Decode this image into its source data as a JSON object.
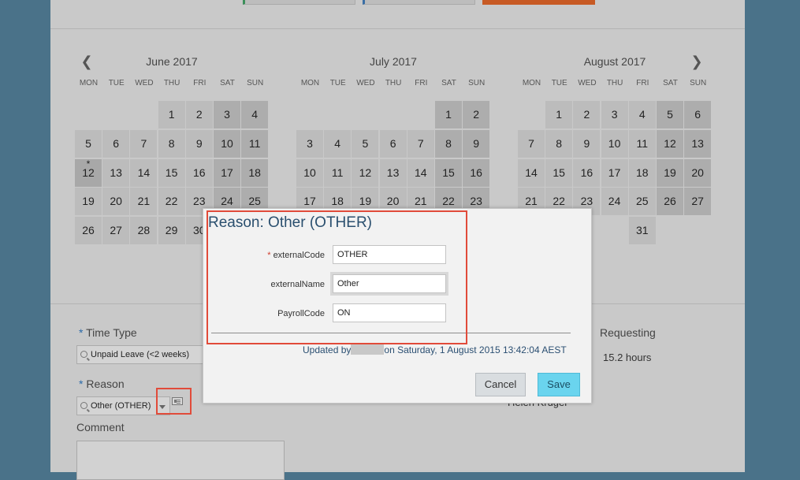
{
  "calendar": {
    "prev_icon": "chevron-left-icon",
    "next_icon": "chevron-right-icon",
    "weekdays": [
      "MON",
      "TUE",
      "WED",
      "THU",
      "FRI",
      "SAT",
      "SUN"
    ],
    "months": [
      {
        "title": "June 2017",
        "weeks": [
          [
            "",
            "",
            "",
            "1",
            "2",
            "3",
            "4"
          ],
          [
            "5",
            "6",
            "7",
            "8",
            "9",
            "10",
            "11"
          ],
          [
            "12",
            "13",
            "14",
            "15",
            "16",
            "17",
            "18"
          ],
          [
            "19",
            "20",
            "21",
            "22",
            "23",
            "24",
            "25"
          ],
          [
            "26",
            "27",
            "28",
            "29",
            "30",
            "",
            ""
          ]
        ],
        "marked_day": "12"
      },
      {
        "title": "July 2017",
        "weeks": [
          [
            "",
            "",
            "",
            "",
            "",
            "1",
            "2"
          ],
          [
            "3",
            "4",
            "5",
            "6",
            "7",
            "8",
            "9"
          ],
          [
            "10",
            "11",
            "12",
            "13",
            "14",
            "15",
            "16"
          ],
          [
            "17",
            "18",
            "19",
            "20",
            "21",
            "22",
            "23"
          ]
        ]
      },
      {
        "title": "August 2017",
        "weeks": [
          [
            "",
            "1",
            "2",
            "3",
            "4",
            "5",
            "6"
          ],
          [
            "7",
            "8",
            "9",
            "10",
            "11",
            "12",
            "13"
          ],
          [
            "14",
            "15",
            "16",
            "17",
            "18",
            "19",
            "20"
          ],
          [
            "21",
            "22",
            "23",
            "24",
            "25",
            "26",
            "27"
          ],
          [
            "",
            "",
            "",
            "",
            "31",
            "",
            ""
          ]
        ]
      }
    ],
    "marker": "*"
  },
  "form": {
    "required_marker": "*",
    "time_type_label": "Time Type",
    "time_type_value": "Unpaid Leave (<2 weeks)",
    "reason_label": "Reason",
    "reason_value": "Other (OTHER)",
    "comment_label": "Comment",
    "requesting_label": "Requesting",
    "requesting_value": "15.2 hours",
    "person_name": "Helen Kruger"
  },
  "modal": {
    "title": "Reason: Other (OTHER)",
    "fields": [
      {
        "label": "externalCode",
        "value": "OTHER",
        "required": true
      },
      {
        "label": "externalName",
        "value": "Other",
        "required": false
      },
      {
        "label": "PayrollCode",
        "value": "ON",
        "required": false
      }
    ],
    "updated_prefix": "Updated by",
    "updated_suffix": "on Saturday, 1 August 2015 13:42:04 AEST",
    "cancel_label": "Cancel",
    "save_label": "Save"
  },
  "colors": {
    "backdrop": "#4a7289",
    "highlight": "#e14b3a",
    "save_button": "#6ad4ee",
    "title": "#2a4f6e"
  }
}
